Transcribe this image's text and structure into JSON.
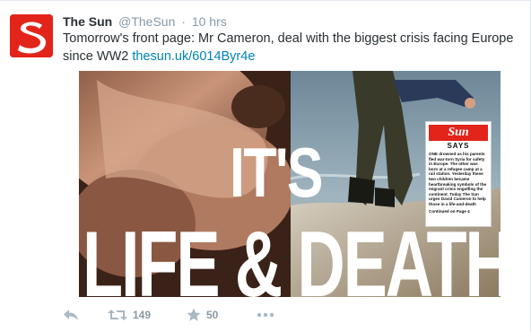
{
  "tweet": {
    "author_name": "The Sun",
    "author_handle": "@TheSun",
    "separator": "·",
    "time": "10 hrs",
    "text": "Tomorrow's front page: Mr Cameron, deal with the biggest crisis facing Europe since WW2 ",
    "link": "thesun.uk/6014Byr4e",
    "avatar_icon": "the-sun-s-logo",
    "brand_color": "#e2241b",
    "link_color": "#0084b4"
  },
  "front_page": {
    "headline_line1": "IT'S",
    "headline_line2": "LIFE & DEATH",
    "box_logo": "Sun",
    "box_title": "SAYS",
    "box_text": "ONE drowned as his parents fled war-torn Syria for safety in Europe. The other was born at a refugee camp at a rail station. Yesterday these two children became heartbreaking symbols of the migrant crisis engulfing the continent. Today The Sun urges David Cameron to help those in a life-and-death",
    "box_continued": "Continued on Page 4"
  },
  "actions": {
    "reply_icon": "reply-icon",
    "retweet_icon": "retweet-icon",
    "retweet_count": "149",
    "favorite_icon": "star-icon",
    "favorite_count": "50",
    "more_icon": "more-icon"
  }
}
